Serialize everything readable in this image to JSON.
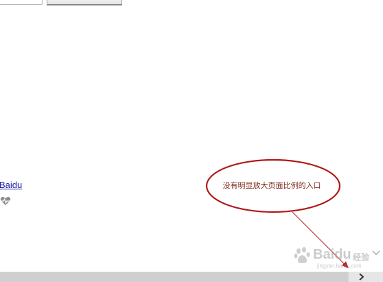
{
  "links": {
    "baidu": "Baidu"
  },
  "annotation": {
    "text": "没有明显放大页面比例的入口",
    "color": "#b01818"
  },
  "watermark": {
    "brand": "Baidu",
    "suffix": "经验",
    "url": "jingyan.baidu.com"
  },
  "icons": {
    "heart": "heart-pulse-icon",
    "chevron_down": "chevron-down-icon",
    "scroll_right": "chevron-right-icon"
  }
}
